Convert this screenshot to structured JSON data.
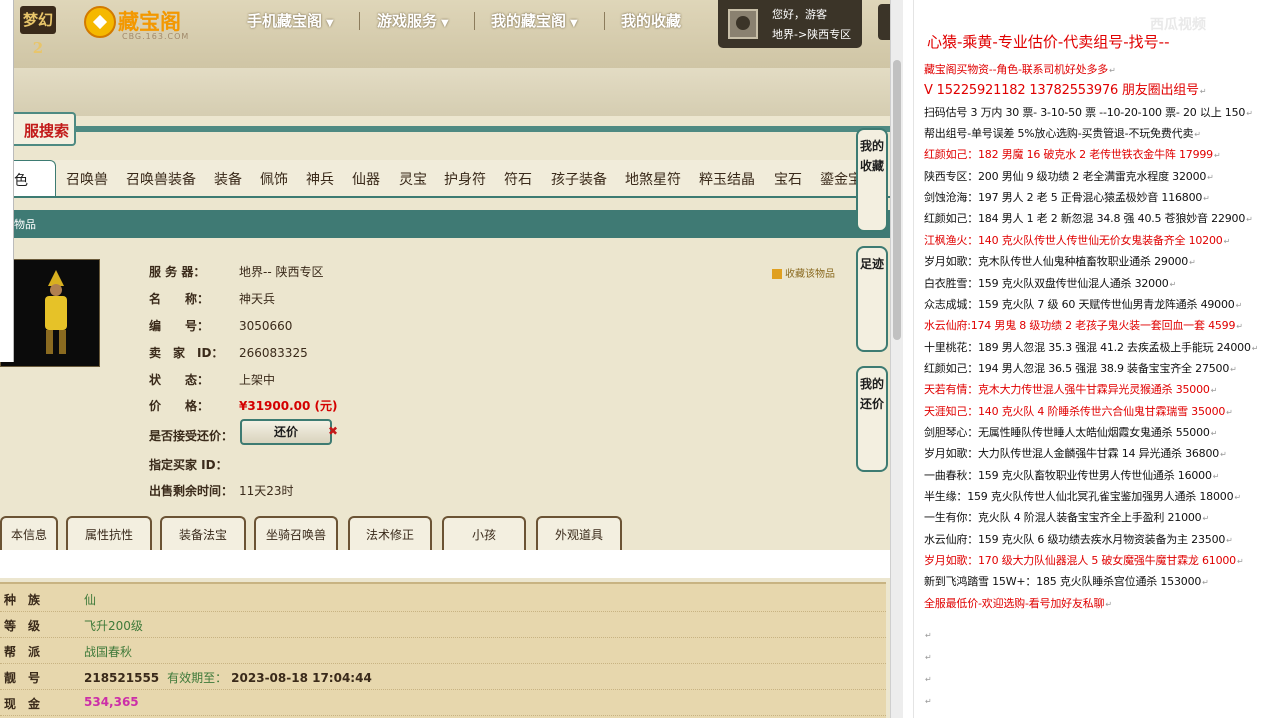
{
  "topnav": {
    "game_logo": "梦幻2",
    "site_name": "藏宝阁",
    "site_sub": "CBG.163.COM",
    "items": [
      "手机藏宝阁",
      "游戏服务",
      "我的藏宝阁",
      "我的收藏"
    ],
    "caret": "▼",
    "user_hello": "您好，游客",
    "user_server": "地界->陕西专区"
  },
  "search": {
    "label": "服搜索"
  },
  "category_tabs": {
    "active": "色",
    "items": [
      "召唤兽",
      "召唤兽装备",
      "装备",
      "佩饰",
      "神兵",
      "仙器",
      "灵宝",
      "护身符",
      "符石",
      "孩子装备",
      "地煞星符",
      "粹玉结晶",
      "宝石",
      "鎏金宝"
    ]
  },
  "section": {
    "label": "物品"
  },
  "item": {
    "fields": [
      {
        "label": "服 务 器：",
        "value": "地界-- 陕西专区"
      },
      {
        "label": "名　　称：",
        "value": "神天兵"
      },
      {
        "label": "编　　号：",
        "value": "3050660"
      },
      {
        "label": "卖　家　ID：",
        "value": "266083325"
      },
      {
        "label": "状　　态：",
        "value": "上架中"
      },
      {
        "label": "价　　格：",
        "value": "¥31900.00 (元)"
      },
      {
        "label": "是否接受还价：",
        "value": ""
      },
      {
        "label": "指定买家 ID：",
        "value": ""
      },
      {
        "label": "出售剩余时间：",
        "value": "11天23时"
      }
    ],
    "counter_offer_label": "还价",
    "counter_close": "✖",
    "favorite_label": "收藏该物品"
  },
  "side_buttons": [
    "我的收藏",
    "足迹",
    "我的还价"
  ],
  "info_tabs": [
    "本信息",
    "属性抗性",
    "装备法宝",
    "坐骑召唤兽",
    "法术修正",
    "小孩",
    "外观道具"
  ],
  "info_table": {
    "rows": [
      {
        "label": "种　族",
        "value": "仙"
      },
      {
        "label": "等　级",
        "value": "飞升200级"
      },
      {
        "label": "帮　派",
        "value": "战国春秋"
      },
      {
        "label": "靓　号",
        "value": "218521555",
        "until_label": "有效期至：",
        "until": "2023-08-18 17:04:44"
      },
      {
        "label": "现　金",
        "value": "534,365"
      }
    ]
  },
  "notes": {
    "watermark": "西瓜视频",
    "title": "心猿-乘黄-专业估价-代卖组号-找号--",
    "lines": [
      {
        "text": "藏宝阁买物资--角色-联系司机好处多多",
        "color": "red"
      },
      {
        "text": "V 15225921182   13782553976 朋友圈出组号",
        "color": "redb"
      },
      {
        "text": "扫码估号 3 万内 30 票- 3-10-50 票  --10-20-100 票- 20 以上 150",
        "color": "blk"
      },
      {
        "text": "帮出组号-单号误差 5%放心选购-买贵管退-不玩免费代卖",
        "color": "blk"
      },
      {
        "text": "红颜如己：182 男魔 16 破克水 2 老传世铁衣金牛阵 17999",
        "color": "red"
      },
      {
        "text": "陕西专区：200 男仙 9 级功绩 2 老全满雷克水程度 32000",
        "color": "blk"
      },
      {
        "text": "剑蚀沧海：197 男人 2 老 5 正骨混心猿孟极妙音 116800",
        "color": "blk"
      },
      {
        "text": "红颜如己：184 男人 1 老 2 新忽混 34.8 强 40.5 苍狼妙音 22900",
        "color": "blk"
      },
      {
        "text": "江枫渔火：140 克火队传世人传世仙无价女鬼装备齐全 10200",
        "color": "red"
      },
      {
        "text": "岁月如歌：克木队传世人仙鬼种植畜牧职业通杀 29000",
        "color": "blk"
      },
      {
        "text": "白衣胜雪：159 克火队双盘传世仙混人通杀 32000",
        "color": "blk"
      },
      {
        "text": "众志成城：159 克火队 7 级 60 天赋传世仙男青龙阵通杀 49000",
        "color": "blk"
      },
      {
        "text": "水云仙府:174 男鬼 8 级功绩 2 老孩子鬼火装一套回血一套 4599",
        "color": "red"
      },
      {
        "text": "十里桃花：189 男人忽混 35.3 强混 41.2 去疾孟极上手能玩 24000",
        "color": "blk"
      },
      {
        "text": "红颜如己：194 男人忽混 36.5 强混 38.9 装备宝宝齐全 27500",
        "color": "blk"
      },
      {
        "text": "天若有情：克木大力传世混人强牛甘霖异光灵猴通杀 35000",
        "color": "red"
      },
      {
        "text": "天涯知己：140 克火队 4 阶睡杀传世六合仙鬼甘霖瑞雪 35000",
        "color": "red"
      },
      {
        "text": "剑胆琴心：无属性睡队传世睡人太皓仙烟霞女鬼通杀 55000",
        "color": "blk"
      },
      {
        "text": "岁月如歌：大力队传世混人金麟强牛甘霖 14 异光通杀 36800",
        "color": "blk"
      },
      {
        "text": "一曲春秋：159 克火队畜牧职业传世男人传世仙通杀 16000",
        "color": "blk"
      },
      {
        "text": "半生缘：159 克火队传世人仙北冥孔雀宝鉴加强男人通杀 18000",
        "color": "blk"
      },
      {
        "text": "一生有你：克火队 4 阶混人装备宝宝齐全上手盈利 21000",
        "color": "blk"
      },
      {
        "text": "水云仙府：159 克火队 6 级功绩去疾水月物资装备为主 23500",
        "color": "blk"
      },
      {
        "text": "岁月如歌：170 级大力队仙器混人 5 破女魔强牛魔甘霖龙 61000",
        "color": "red"
      },
      {
        "text": "新到飞鸿踏雪 15W+：185 克火队睡杀宫位通杀 153000",
        "color": "blk"
      },
      {
        "text": "全服最低价-欢迎选购-看号加好友私聊",
        "color": "red"
      }
    ],
    "para_mark": "↵"
  }
}
